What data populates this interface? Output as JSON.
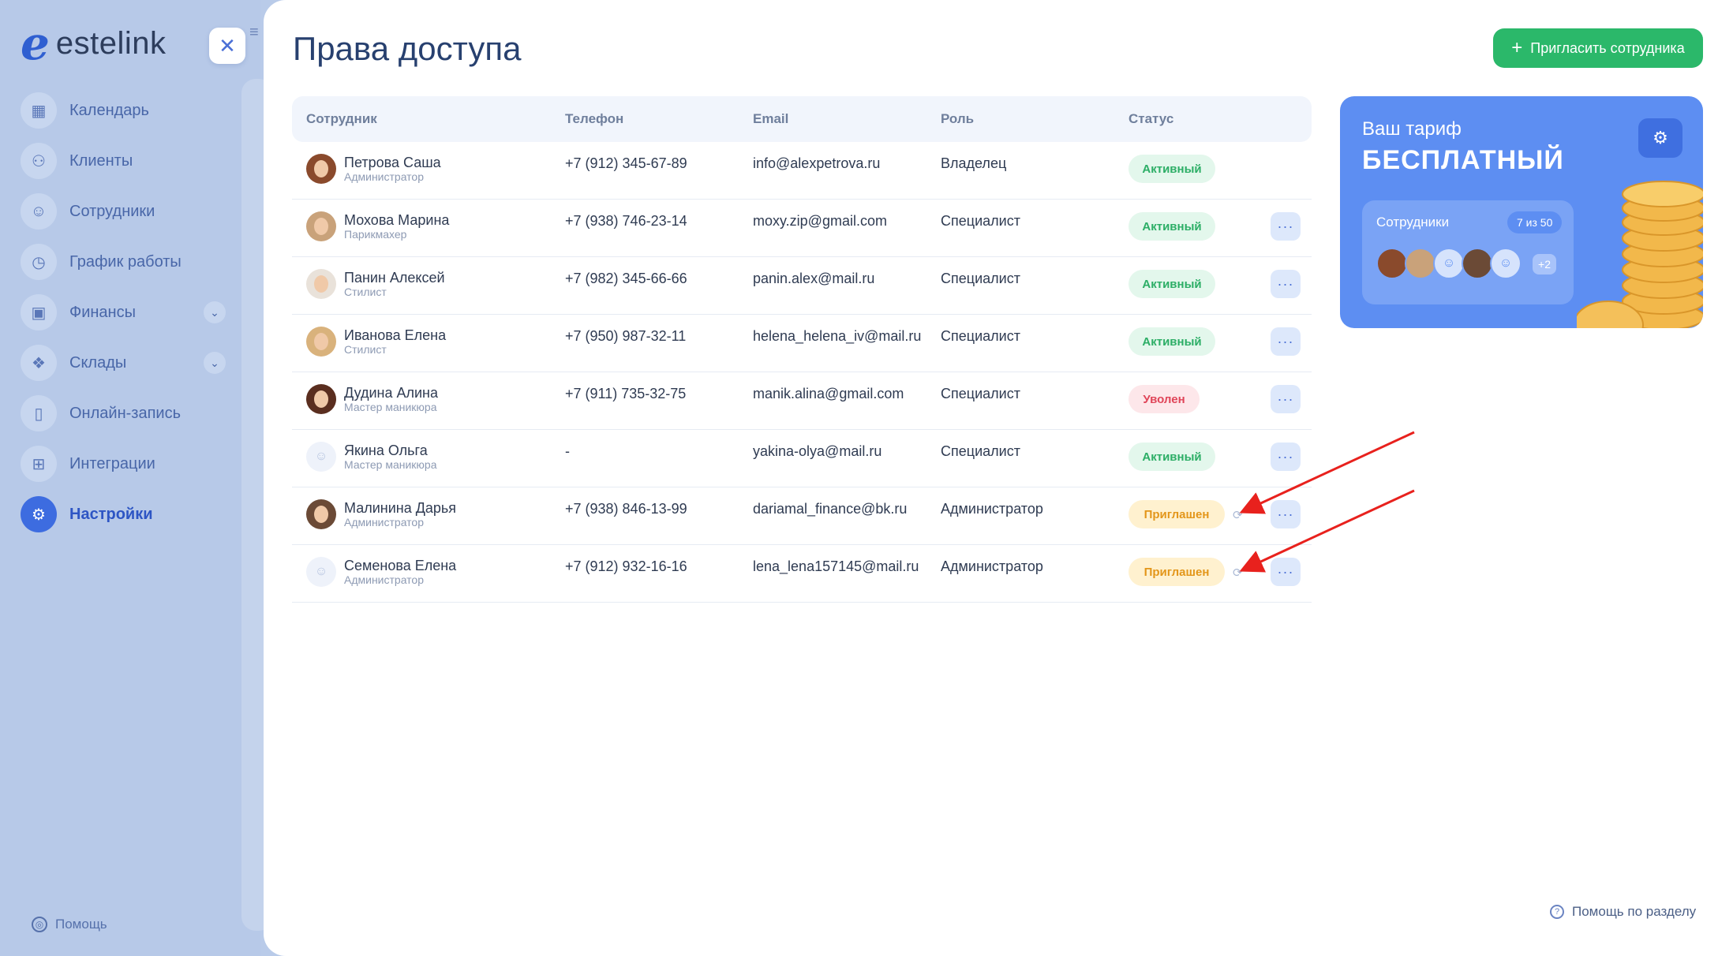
{
  "app": {
    "logo_mark": "e",
    "logo_text": "estelink"
  },
  "sidebar": {
    "items": [
      {
        "label": "Календарь",
        "icon": "calendar-icon"
      },
      {
        "label": "Клиенты",
        "icon": "clients-icon"
      },
      {
        "label": "Сотрудники",
        "icon": "user-icon"
      },
      {
        "label": "График работы",
        "icon": "clock-icon"
      },
      {
        "label": "Финансы",
        "icon": "wallet-icon",
        "expandable": true
      },
      {
        "label": "Склады",
        "icon": "boxes-icon",
        "expandable": true
      },
      {
        "label": "Онлайн-запись",
        "icon": "phone-icon"
      },
      {
        "label": "Интеграции",
        "icon": "grid-plus-icon"
      },
      {
        "label": "Настройки",
        "icon": "gear-icon",
        "active": true
      }
    ],
    "help_label": "Помощь"
  },
  "header": {
    "title": "Права доступа",
    "invite_label": "Пригласить сотрудника"
  },
  "table": {
    "columns": [
      "Сотрудник",
      "Телефон",
      "Email",
      "Роль",
      "Статус"
    ],
    "rows": [
      {
        "name": "Петрова Саша",
        "position": "Администратор",
        "phone": "+7 (912) 345-67-89",
        "email": "info@alexpetrova.ru",
        "role": "Владелец",
        "status": "Активный",
        "status_type": "active"
      },
      {
        "name": "Мохова Марина",
        "position": "Парикмахер",
        "phone": "+7 (938) 746-23-14",
        "email": "moxy.zip@gmail.com",
        "role": "Специалист",
        "status": "Активный",
        "status_type": "active"
      },
      {
        "name": "Панин Алексей",
        "position": "Стилист",
        "phone": "+7 (982) 345-66-66",
        "email": "panin.alex@mail.ru",
        "role": "Специалист",
        "status": "Активный",
        "status_type": "active"
      },
      {
        "name": "Иванова Елена",
        "position": "Стилист",
        "phone": "+7 (950) 987-32-11",
        "email": "helena_helena_iv@mail.ru",
        "role": "Специалист",
        "status": "Активный",
        "status_type": "active"
      },
      {
        "name": "Дудина Алина",
        "position": "Мастер маникюра",
        "phone": "+7 (911) 735-32-75",
        "email": "manik.alina@gmail.com",
        "role": "Специалист",
        "status": "Уволен",
        "status_type": "fired"
      },
      {
        "name": "Якина Ольга",
        "position": "Мастер маникюра",
        "phone": "-",
        "email": "yakina-olya@mail.ru",
        "role": "Специалист",
        "status": "Активный",
        "status_type": "active"
      },
      {
        "name": "Малинина Дарья",
        "position": "Администратор",
        "phone": "+7 (938) 846-13-99",
        "email": "dariamal_finance@bk.ru",
        "role": "Администратор",
        "status": "Приглашен",
        "status_type": "invited"
      },
      {
        "name": "Семенова Елена",
        "position": "Администратор",
        "phone": "+7 (912) 932-16-16",
        "email": "lena_lena157145@mail.ru",
        "role": "Администратор",
        "status": "Приглашен",
        "status_type": "invited"
      }
    ]
  },
  "tariff": {
    "label": "Ваш тариф",
    "plan": "БЕСПЛАТНЫЙ",
    "employees_label": "Сотрудники",
    "employees_count": "7 из 50",
    "more_count": "+2"
  },
  "footer": {
    "help_section": "Помощь по разделу"
  },
  "colors": {
    "accent": "#3d6ce0",
    "invite": "#2bb86a",
    "tariff": "#5d8ef2",
    "arrow": "#e8211d"
  }
}
